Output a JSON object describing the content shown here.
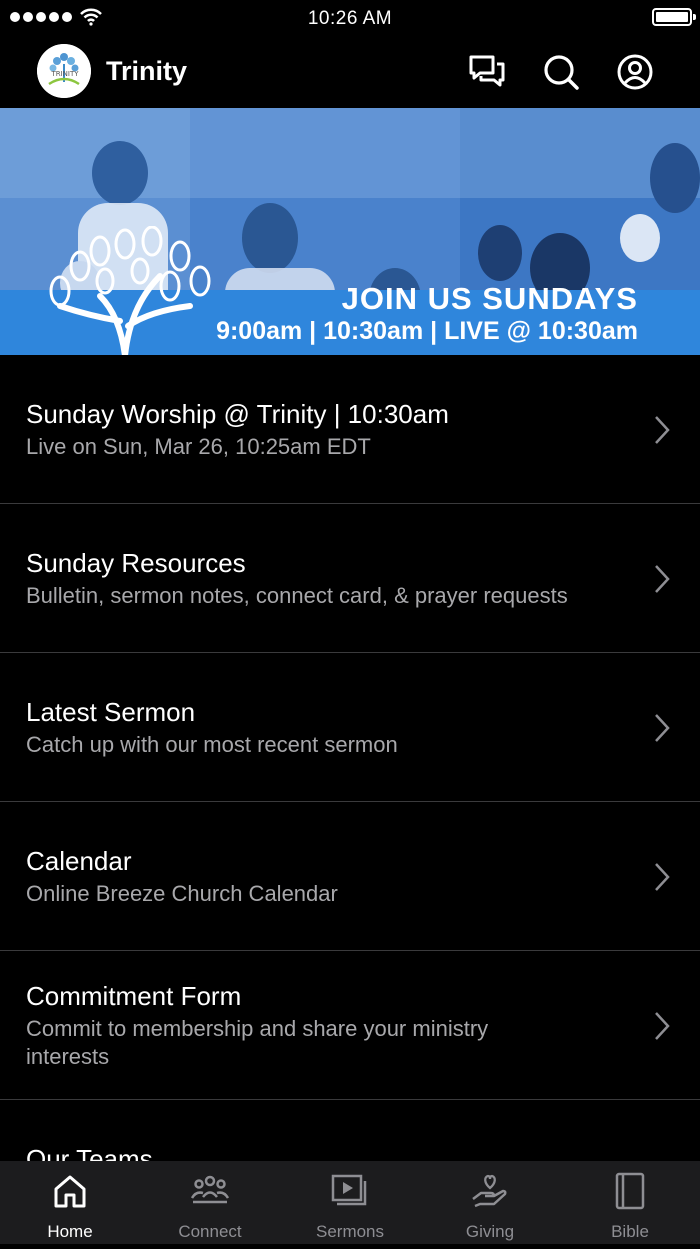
{
  "status_bar": {
    "time": "10:26 AM"
  },
  "header": {
    "title": "Trinity",
    "logo_text": "TRINITY"
  },
  "banner": {
    "headline": "JOIN US SUNDAYS",
    "times": "9:00am | 10:30am | LIVE @ 10:30am",
    "strip_color": "#2f86dc",
    "tint_color": "#3e78c8"
  },
  "list": {
    "items": [
      {
        "title": "Sunday Worship @ Trinity | 10:30am",
        "subtitle": "Live on Sun, Mar 26, 10:25am EDT"
      },
      {
        "title": "Sunday Resources",
        "subtitle": "Bulletin, sermon notes, connect card, & prayer requests"
      },
      {
        "title": "Latest Sermon",
        "subtitle": "Catch up with our most recent sermon"
      },
      {
        "title": "Calendar",
        "subtitle": "Online Breeze Church Calendar"
      },
      {
        "title": "Commitment Form",
        "subtitle": "Commit to membership and share your ministry interests"
      },
      {
        "title": "Our Teams",
        "subtitle": ""
      }
    ]
  },
  "tabs": [
    {
      "label": "Home",
      "icon": "home-icon",
      "active": true
    },
    {
      "label": "Connect",
      "icon": "people-icon",
      "active": false
    },
    {
      "label": "Sermons",
      "icon": "play-stack-icon",
      "active": false
    },
    {
      "label": "Giving",
      "icon": "heart-hand-icon",
      "active": false
    },
    {
      "label": "Bible",
      "icon": "book-icon",
      "active": false
    }
  ]
}
